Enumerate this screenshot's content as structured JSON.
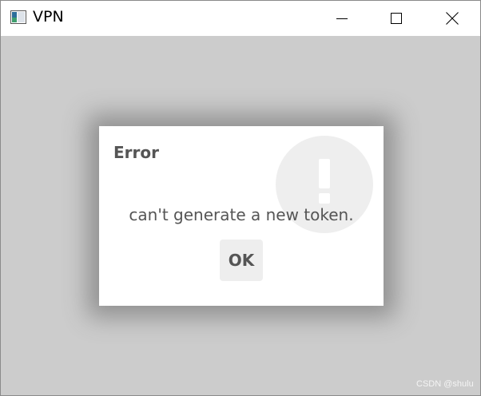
{
  "window": {
    "title": "VPN",
    "controls": {
      "minimize_icon": "minimize-icon",
      "maximize_icon": "maximize-icon",
      "close_icon": "close-icon"
    }
  },
  "dialog": {
    "title": "Error",
    "message": "can't generate a new token.",
    "ok_label": "OK",
    "badge_icon": "exclamation-icon"
  },
  "watermark": "CSDN @shulu",
  "colors": {
    "client_background": "#cccccc",
    "dialog_background": "#ffffff",
    "dialog_text": "#555555",
    "button_background": "#eeeeee",
    "badge_background": "#eeeeee"
  }
}
